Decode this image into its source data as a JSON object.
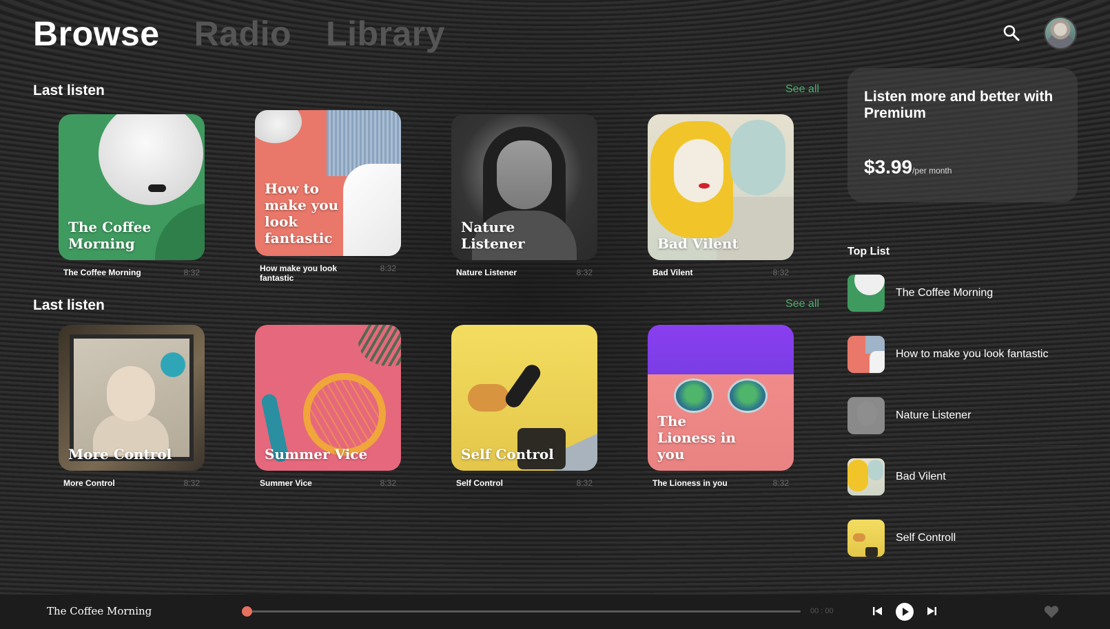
{
  "nav": {
    "tabs": [
      "Browse",
      "Radio",
      "Library"
    ],
    "active": "Browse"
  },
  "sections": [
    {
      "title": "Last listen",
      "see_all": "See all",
      "cards": [
        {
          "cover_text": "The Coffee Morning",
          "name": "The Coffee Morning",
          "duration": "8:32"
        },
        {
          "cover_text": "How to make you look fantastic",
          "name": "How make you look fantastic",
          "duration": "8:32"
        },
        {
          "cover_text": "Nature Listener",
          "name": "Nature Listener",
          "duration": "8:32"
        },
        {
          "cover_text": "Bad Vilent",
          "name": "Bad Vilent",
          "duration": "8:32"
        }
      ]
    },
    {
      "title": "Last listen",
      "see_all": "See all",
      "cards": [
        {
          "cover_text": "More Control",
          "name": "More Control",
          "duration": "8:32"
        },
        {
          "cover_text": "Summer Vice",
          "name": "Summer Vice",
          "duration": "8:32"
        },
        {
          "cover_text": "Self Control",
          "name": "Self Control",
          "duration": "8:32"
        },
        {
          "cover_text": "The Lioness in you",
          "name": "The Lioness in you",
          "duration": "8:32"
        }
      ]
    }
  ],
  "premium": {
    "title": "Listen more and better with Premium",
    "price": "$3.99",
    "period": "/per month"
  },
  "top_list": {
    "title": "Top List",
    "items": [
      "The Coffee Morning",
      "How to make you look fantastic",
      "Nature Listener",
      "Bad Vilent",
      "Self Controll"
    ]
  },
  "player": {
    "now_playing": "The Coffee Morning",
    "time": "00 : 00",
    "progress": 0
  },
  "colors": {
    "accent": "#e8705f",
    "see_all": "#4caf6e",
    "background": "#2b2b2b"
  },
  "icons": {
    "search": "search-icon",
    "previous": "skip-previous-icon",
    "play": "play-icon",
    "next": "skip-next-icon",
    "like": "heart-icon"
  }
}
